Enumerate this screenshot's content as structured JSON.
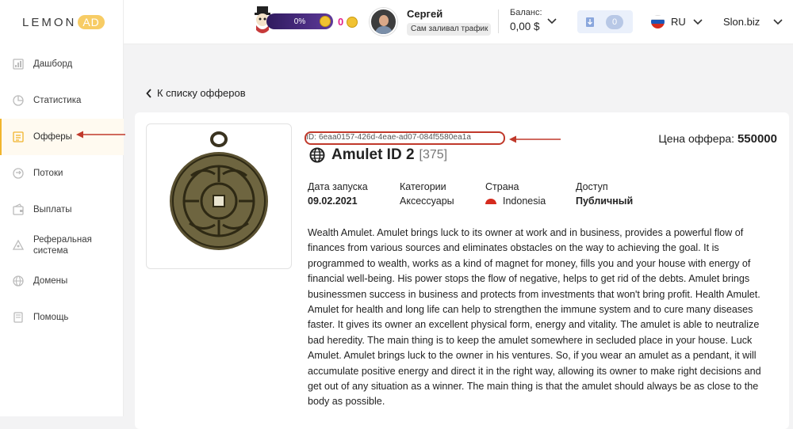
{
  "brand": {
    "part1": "LEMON",
    "part2": "AD"
  },
  "sidebar": {
    "items": [
      {
        "label": "Дашборд",
        "icon": "dashboard-icon"
      },
      {
        "label": "Статистика",
        "icon": "statistics-icon"
      },
      {
        "label": "Офферы",
        "icon": "offers-icon",
        "active": true
      },
      {
        "label": "Потоки",
        "icon": "flows-icon"
      },
      {
        "label": "Выплаты",
        "icon": "payouts-icon"
      },
      {
        "label": "Реферальная система",
        "icon": "referral-icon"
      },
      {
        "label": "Домены",
        "icon": "domains-icon"
      },
      {
        "label": "Помощь",
        "icon": "help-icon"
      }
    ]
  },
  "header": {
    "progress_percent": "0%",
    "coins": "0",
    "user_name": "Сергей",
    "user_status": "Сам заливал трафик",
    "balance_label": "Баланс:",
    "balance_value": "0,00 $",
    "downloads_count": "0",
    "language": "RU",
    "site": "Slon.biz"
  },
  "back_link": "К списку офферов",
  "offer": {
    "id_text": "ID: 6eaa0157-426d-4eae-ad07-084f5580ea1a",
    "name": "Amulet ID 2",
    "number": "[375]",
    "price_label": "Цена оффера:",
    "price_value": "550000",
    "launch_label": "Дата запуска",
    "launch_value": "09.02.2021",
    "category_label": "Категории",
    "category_value": "Аксессуары",
    "country_label": "Страна",
    "country_value": "Indonesia",
    "access_label": "Доступ",
    "access_value": "Публичный",
    "description": "Wealth Amulet. Amulet brings luck to its owner at work and in business, provides a powerful flow of finances from various sources and eliminates obstacles on the way to achieving the goal. It is programmed to wealth, works as a kind of magnet for money, fills you and your house with energy of financial well-being. His power stops the flow of negative, helps to get rid of the debts. Amulet brings businessmen success in business and protects from investments that won't bring profit. Health Amulet. Amulet for health and long life can help to strengthen the immune system and to cure many diseases faster. It gives its owner an excellent physical form, energy and vitality. The amulet is able to neutralize bad heredity. The main thing is to keep the amulet somewhere in secluded place in your house. Luck Amulet. Amulet brings luck to the owner in his ventures. So, if you wear an amulet as a pendant, it will accumulate positive energy and direct it in the right way, allowing its owner to make right decisions and get out of any situation as a winner.  The main thing is that the amulet should always be as close to the body as possible."
  },
  "colors": {
    "accent": "#f1b52d",
    "annotation": "#c0392b",
    "coins": "#e0218a"
  }
}
